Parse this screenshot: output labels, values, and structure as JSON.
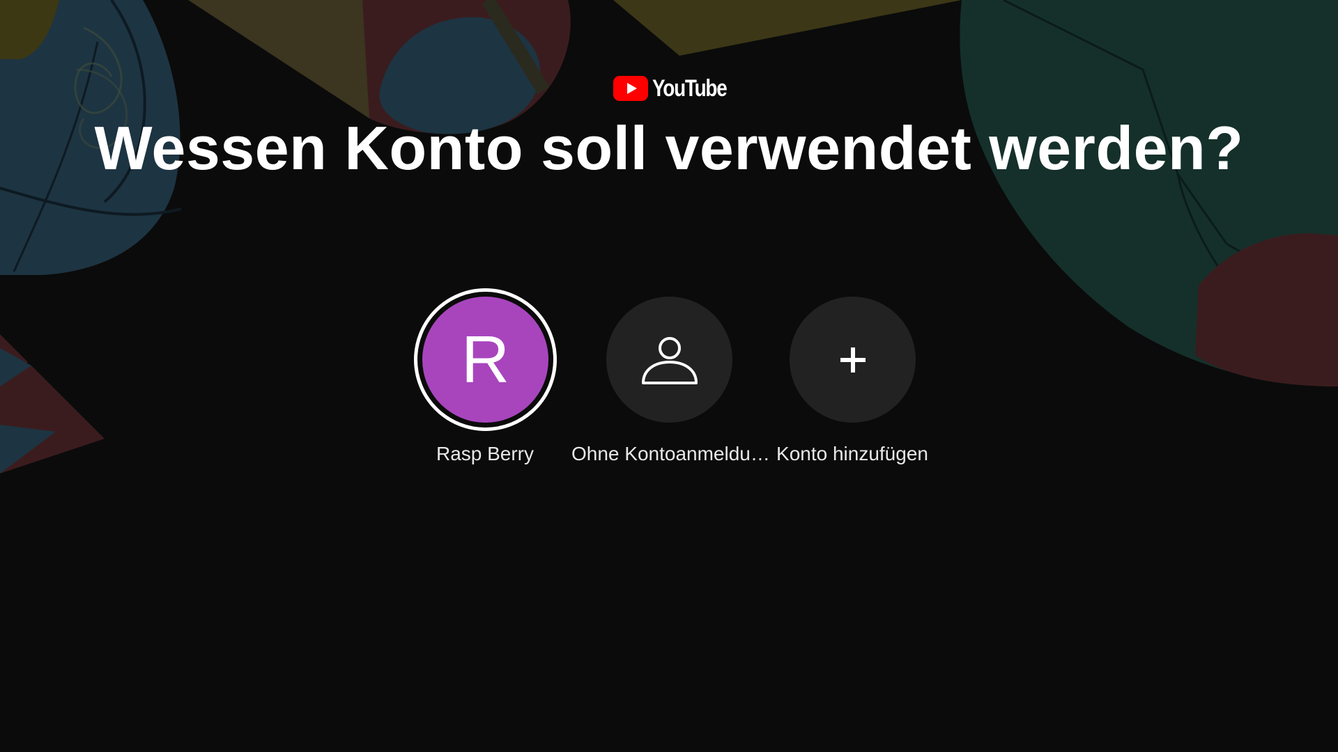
{
  "brand": {
    "name": "YouTube",
    "logo_red": "#ff0000"
  },
  "heading": "Wessen Konto soll verwendet werden?",
  "accounts": [
    {
      "label": "Rasp Berry",
      "avatar_letter": "R",
      "avatar_color": "#a845bd",
      "selected": true
    },
    {
      "label": "Ohne Kontoanmeldu…",
      "icon": "person-icon",
      "avatar_color": "#222222",
      "selected": false
    },
    {
      "label": "Konto hinzufügen",
      "icon": "plus-icon",
      "avatar_color": "#222222",
      "selected": false
    }
  ]
}
